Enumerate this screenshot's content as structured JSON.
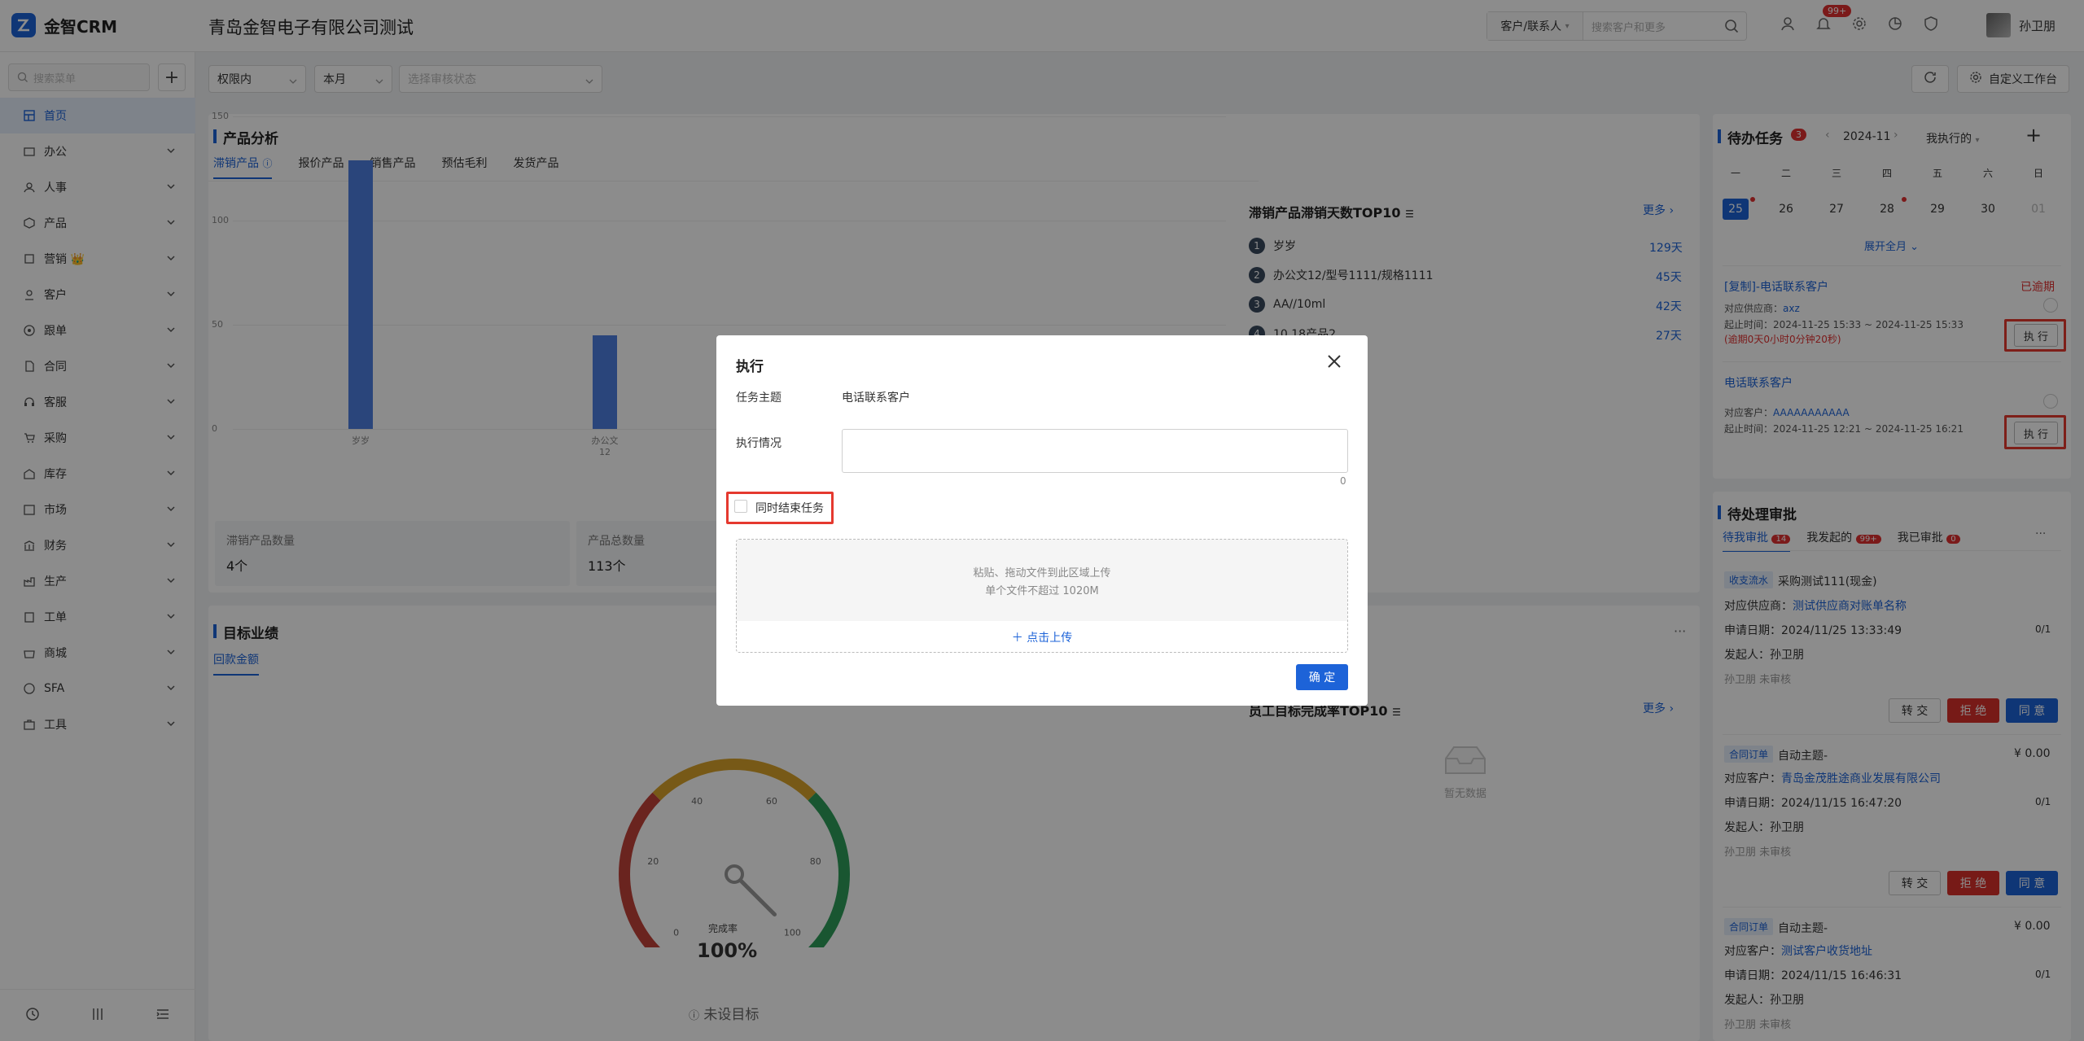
{
  "header": {
    "logo_mark": "CRM",
    "logo_text": "金智CRM",
    "company": "青岛金智电子有限公司测试",
    "search_scope": "客户/联系人",
    "search_placeholder": "搜索客户和更多",
    "notif_count": "99+",
    "user_name": "孙卫朋"
  },
  "sidebar": {
    "search_placeholder": "搜索菜单",
    "items": [
      {
        "label": "首页"
      },
      {
        "label": "办公"
      },
      {
        "label": "人事"
      },
      {
        "label": "产品"
      },
      {
        "label": "营销 👑"
      },
      {
        "label": "客户"
      },
      {
        "label": "跟单"
      },
      {
        "label": "合同"
      },
      {
        "label": "客服"
      },
      {
        "label": "采购"
      },
      {
        "label": "库存"
      },
      {
        "label": "市场"
      },
      {
        "label": "财务"
      },
      {
        "label": "生产"
      },
      {
        "label": "工单"
      },
      {
        "label": "商城"
      },
      {
        "label": "SFA"
      },
      {
        "label": "工具"
      }
    ]
  },
  "filters": {
    "scope": "权限内",
    "period": "本月",
    "audit_placeholder": "选择审核状态",
    "custom_btn": "自定义工作台"
  },
  "product": {
    "title": "产品分析",
    "tabs": [
      "滞销产品",
      "报价产品",
      "销售产品",
      "预估毛利",
      "发货产品"
    ],
    "stat1_label": "滞销产品数量",
    "stat1_value": "4个",
    "stat2_label": "产品总数量",
    "stat2_value": "113个",
    "rank_title": "滞销产品滞销天数TOP10",
    "more": "更多",
    "ranks": [
      {
        "no": "1",
        "name": "岁岁",
        "days": "129天"
      },
      {
        "no": "2",
        "name": "办公文12/型号1111/规格1111",
        "days": "45天"
      },
      {
        "no": "3",
        "name": "AA//10ml",
        "days": "42天"
      },
      {
        "no": "4",
        "name": "10.18产品2",
        "days": "27天"
      }
    ]
  },
  "chart_data": {
    "type": "bar",
    "categories": [
      "岁岁",
      "办公文12"
    ],
    "values": [
      129,
      45
    ],
    "ylim": [
      0,
      150
    ],
    "yticks": [
      "150",
      "100",
      "50",
      "0"
    ],
    "title": "",
    "xlabel": "",
    "ylabel": ""
  },
  "goal": {
    "title": "目标业绩",
    "tab": "回款金额",
    "gauge_ticks": [
      "0",
      "20",
      "40",
      "60",
      "80",
      "100"
    ],
    "gauge_label": "完成率",
    "gauge_value": "100%",
    "gauge_percent": 100,
    "no_goal": "未设目标",
    "rank_title": "员工目标完成率TOP10",
    "more": "更多",
    "empty": "暂无数据"
  },
  "tasks": {
    "title": "待办任务",
    "count": "3",
    "month": "2024-11",
    "filter": "我执行的",
    "weekdays": [
      "一",
      "二",
      "三",
      "四",
      "五",
      "六",
      "日"
    ],
    "days": [
      "25",
      "26",
      "27",
      "28",
      "29",
      "30",
      "01"
    ],
    "expand": "展开全月",
    "items": [
      {
        "title": "[复制]-电话联系客户",
        "status": "已逾期",
        "rel_label": "对应供应商：",
        "rel_value": "axz",
        "time": "起止时间：2024-11-25 15:33 ~ 2024-11-25 15:33",
        "overdue": "(逾期0天0小时0分钟20秒)",
        "btn": "执 行"
      },
      {
        "title": "电话联系客户",
        "rel_label": "对应客户：",
        "rel_value": "AAAAAAAAAAA",
        "time": "起止时间：2024-11-25 12:21 ~ 2024-11-25 16:21",
        "btn": "执 行"
      }
    ]
  },
  "approvals": {
    "title": "待处理审批",
    "tabs": [
      {
        "label": "待我审批",
        "badge": "14"
      },
      {
        "label": "我发起的",
        "badge": "99+"
      },
      {
        "label": "我已审批",
        "badge": "0"
      }
    ],
    "items": [
      {
        "tag": "收支流水",
        "subject": "采购测试111(现金)",
        "amount": "",
        "rel_label": "对应供应商：",
        "rel_value": "测试供应商对账单名称",
        "date": "申请日期：2024/11/25 13:33:49",
        "progress": "0/1",
        "initiator": "发起人：孙卫朋",
        "state": "孙卫朋 未审核",
        "btns": [
          "转 交",
          "拒 绝",
          "同 意"
        ]
      },
      {
        "tag": "合同订单",
        "subject": "自动主题-",
        "amount": "¥ 0.00",
        "rel_label": "对应客户：",
        "rel_value": "青岛金茂胜途商业发展有限公司",
        "date": "申请日期：2024/11/15 16:47:20",
        "progress": "0/1",
        "initiator": "发起人：孙卫朋",
        "state": "孙卫朋 未审核",
        "btns": [
          "转 交",
          "拒 绝",
          "同 意"
        ]
      },
      {
        "tag": "合同订单",
        "subject": "自动主题-",
        "amount": "¥ 0.00",
        "rel_label": "对应客户：",
        "rel_value": "测试客户收货地址",
        "date": "申请日期：2024/11/15 16:46:31",
        "progress": "0/1",
        "initiator": "发起人：孙卫朋",
        "state": "孙卫朋 未审核"
      }
    ]
  },
  "modal": {
    "title": "执行",
    "subject_label": "任务主题",
    "subject_value": "电话联系客户",
    "status_label": "执行情况",
    "char_count": "0",
    "checkbox_label": "同时结束任务",
    "upload_line1": "粘贴、拖动文件到此区域上传",
    "upload_line2": "单个文件不超过 1020M",
    "upload_btn": "＋ 点击上传",
    "ok": "确 定"
  },
  "colors": {
    "primary": "#1d63d8",
    "danger": "#e03131",
    "highlight": "#e5392f"
  }
}
